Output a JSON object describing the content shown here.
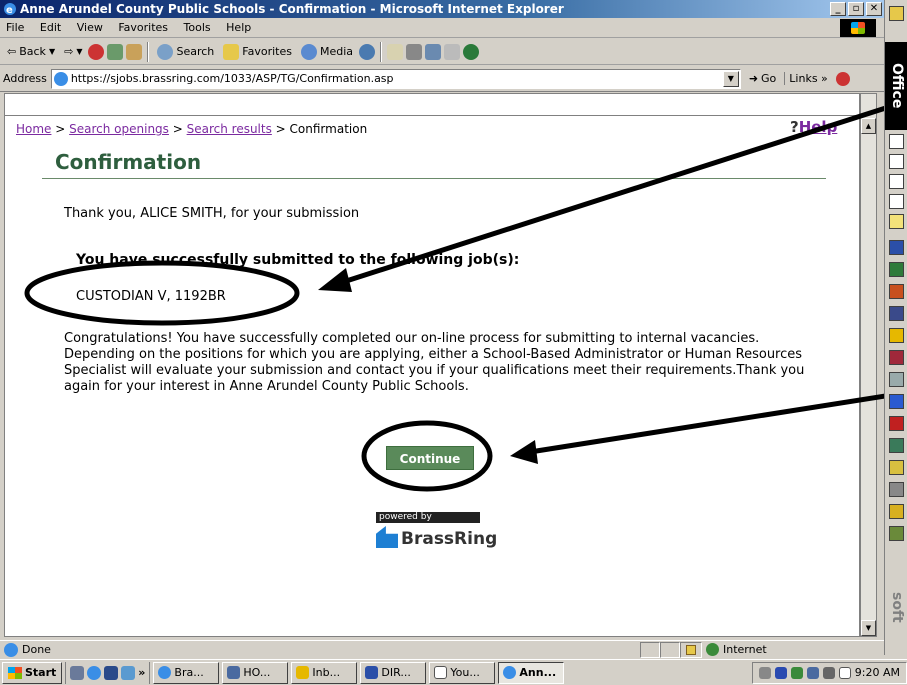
{
  "window": {
    "title": "Anne Arundel County Public Schools - Confirmation - Microsoft Internet Explorer",
    "min": "_",
    "max": "▫",
    "close": "✕"
  },
  "menu": [
    "File",
    "Edit",
    "View",
    "Favorites",
    "Tools",
    "Help"
  ],
  "toolbar": {
    "back": "Back",
    "search": "Search",
    "favorites": "Favorites",
    "media": "Media"
  },
  "address": {
    "label": "Address",
    "url": "https://sjobs.brassring.com/1033/ASP/TG/Confirmation.asp",
    "go": "Go",
    "links": "Links »"
  },
  "breadcrumb": {
    "home": "Home",
    "sep": " > ",
    "search_openings": "Search openings",
    "search_results": "Search results",
    "current": "Confirmation"
  },
  "help": {
    "q": "?",
    "label": "Help"
  },
  "page": {
    "title": "Confirmation",
    "thanks": "Thank you, ALICE SMITH, for your submission",
    "success": "You have successfully submitted to the following job(s):",
    "job": "CUSTODIAN V, 1192BR",
    "congrats": "Congratulations! You have successfully completed our on-line process for submitting to internal vacancies. Depending on the positions for which you are applying, either a School-Based Administrator or Human Resources Specialist will evaluate your submission and contact you if your qualifications meet their requirements.Thank you again for your interest in Anne Arundel County Public Schools.",
    "continue": "Continue"
  },
  "powered": {
    "by": "powered by",
    "brand": "BrassRing"
  },
  "officebar": {
    "top": "Office",
    "bottom": "soft"
  },
  "status": {
    "done": "Done",
    "zone": "Internet"
  },
  "taskbar": {
    "start": "Start",
    "tasks": [
      "Bra...",
      "HO...",
      "Inb...",
      "DIR...",
      "You...",
      "Ann..."
    ],
    "more": "»",
    "clock": "9:20 AM"
  },
  "colors": {
    "title_green": "#2e5e3e",
    "button_green": "#5a8a5a",
    "link_purple": "#7b2aa0"
  }
}
